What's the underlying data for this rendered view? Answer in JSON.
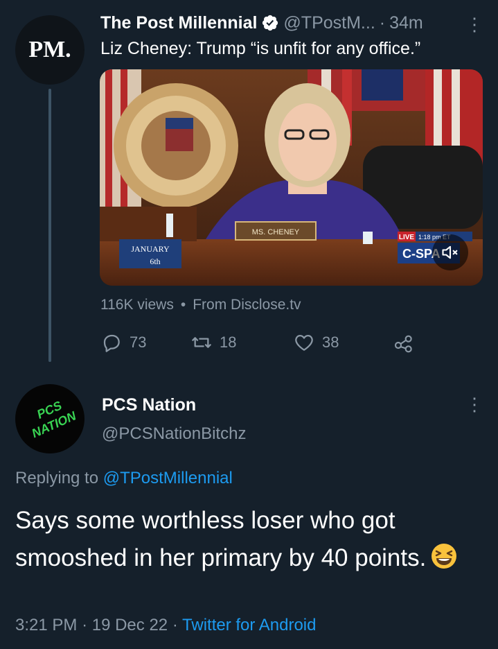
{
  "tweet1": {
    "avatar_text": "PM.",
    "name": "The Post Millennial",
    "handle": "@TPostM...",
    "separator": "·",
    "time": "34m",
    "more_label": "⋮",
    "text": "Liz Cheney: Trump “is unfit for any office.”",
    "media": {
      "nameplate": "MS. CHENEY",
      "badge_line1": "JANUARY",
      "badge_line2": "6th",
      "live_label": "LIVE",
      "live_time": "1:18 pm ET",
      "network": "C-SPA"
    },
    "views": "116K views",
    "source": "From Disclose.tv",
    "stats": {
      "replies": "73",
      "retweets": "18",
      "likes": "38"
    }
  },
  "reply": {
    "avatar_text": "PCS NATION",
    "name": "PCS Nation",
    "handle": "@PCSNationBitchz",
    "more_label": "⋮",
    "replying_prefix": "Replying to",
    "replying_handle": "@TPostMillennial",
    "text": "Says some worthless loser who got smooshed in her primary by 40 points.",
    "time": "3:21 PM",
    "sep": "·",
    "date": "19 Dec 22",
    "client": "Twitter for Android"
  },
  "colors": {
    "background": "#15202b",
    "text_primary": "#ffffff",
    "text_secondary": "#8b98a5",
    "link": "#1d9bf0",
    "avatar_logo_green": "#39d353"
  },
  "icons": [
    "verified-badge-icon",
    "more-icon",
    "mute-icon",
    "reply-icon",
    "retweet-icon",
    "like-icon",
    "share-icon",
    "grinning-squinting-emoji"
  ]
}
